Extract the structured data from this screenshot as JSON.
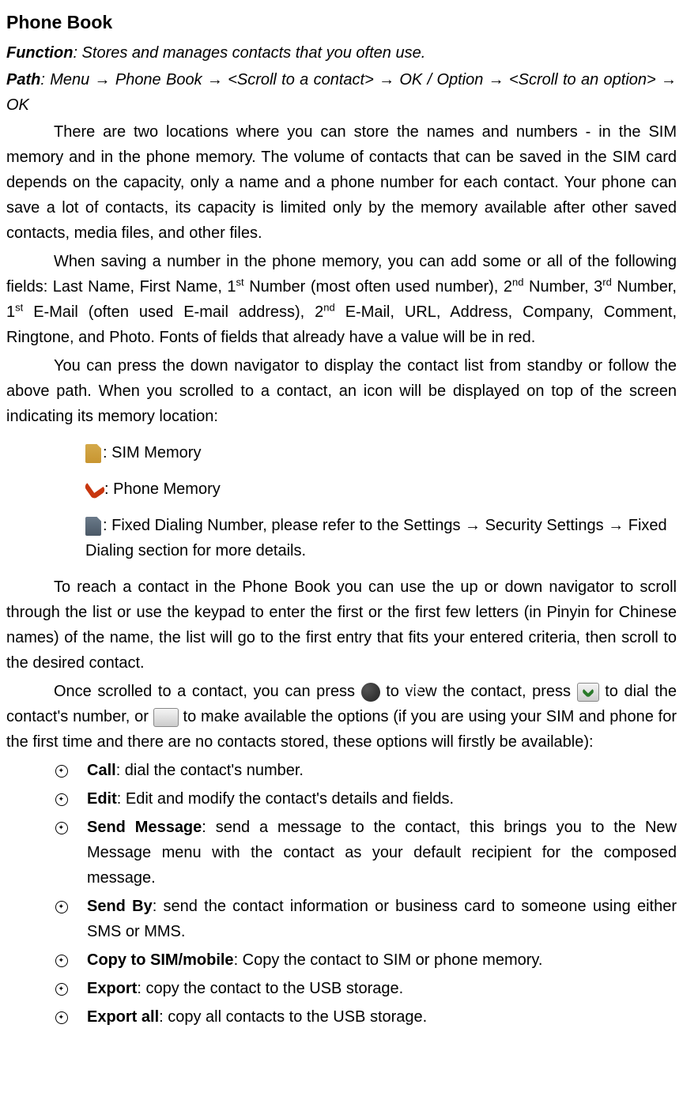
{
  "title": "Phone Book",
  "function_label": "Function",
  "function_text": ": Stores and manages contacts that you often use.",
  "path_label": "Path",
  "path_text": ": Menu → Phone Book → <Scroll to a contact> → OK / Option → <Scroll to an option> → OK",
  "para1": "There are two locations where you can store the names and numbers - in the SIM memory and in the phone memory. The volume of contacts that can be saved in the SIM card depends on the capacity, only a name and a phone number for each contact. Your phone can save a lot of contacts, its capacity is limited only by the memory available after other saved contacts, media files, and other files.",
  "para2_a": "When saving a number in the phone memory, you can add some or all of the following fields: Last Name, First Name, 1",
  "para2_b": " Number (most often used number), 2",
  "para2_c": " Number, 3",
  "para2_d": " Number, 1",
  "para2_e": " E-Mail (often used E-mail address), 2",
  "para2_f": " E-Mail, URL, Address, Company, Comment, Ringtone, and Photo. Fonts of fields that already have a value will be in red.",
  "sup_st": "st",
  "sup_nd": "nd",
  "sup_rd": "rd",
  "para3": "You can press the down navigator to display the contact list from standby or follow the above path. When you scrolled to a contact, an icon will be displayed on top of the screen indicating its memory location:",
  "icon1_text": ": SIM Memory",
  "icon2_text": ": Phone Memory",
  "icon3_text": ": Fixed Dialing Number, please refer to the Settings → Security Settings → Fixed Dialing section for more details.",
  "para4": "To reach a contact in the Phone Book you can use the up or down navigator to scroll through the list or use the keypad to enter the first or the first few letters (in Pinyin for Chinese names) of the name, the list will go to the first entry that fits your entered criteria, then scroll to the desired contact.",
  "para5_a": "Once scrolled to a contact, you can press ",
  "para5_b": " to view the contact, press ",
  "para5_c": " to dial the contact's number, or ",
  "para5_d": " to make available the options (if you are using your SIM and phone for the first time and there are no contacts stored, these options will firstly be available):",
  "ok_label": "OK",
  "bullets": [
    {
      "bold": "Call",
      "text": ": dial the contact's number."
    },
    {
      "bold": "Edit",
      "text": ": Edit and modify the contact's details and fields."
    },
    {
      "bold": "Send Message",
      "text": ": send a message to the contact, this brings you to the New Message menu with the contact as your default recipient for the composed message."
    },
    {
      "bold": "Send By",
      "text": ": send the contact information or business card to someone using either SMS or MMS."
    },
    {
      "bold": "Copy to SIM/mobile",
      "text": ": Copy the contact to SIM or phone memory."
    },
    {
      "bold": "Export",
      "text": ": copy the contact to the USB storage."
    },
    {
      "bold": "Export all",
      "text": ": copy all contacts to the USB storage."
    }
  ]
}
